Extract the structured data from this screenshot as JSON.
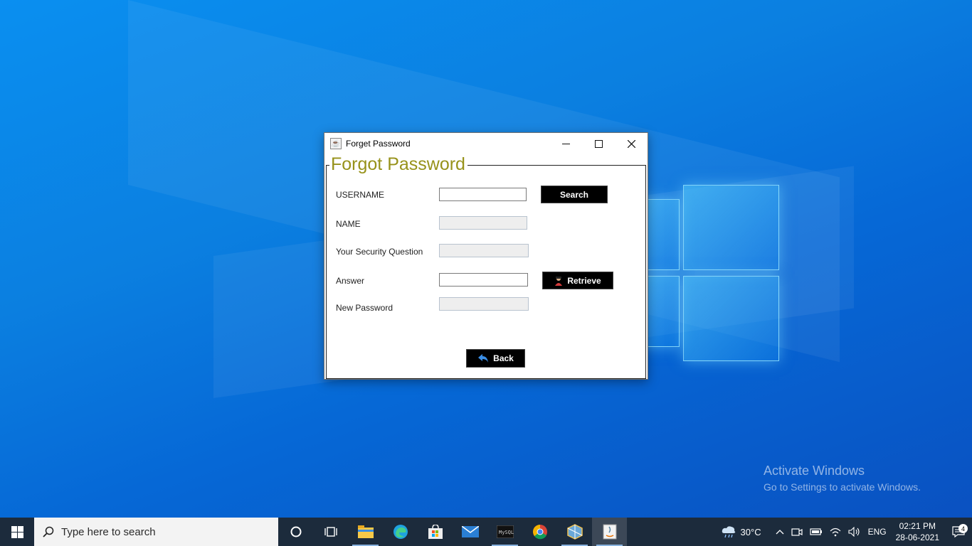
{
  "window": {
    "title": "Forget Password",
    "panel_title": "Forgot Password"
  },
  "form": {
    "username_label": "USERNAME",
    "username_value": "",
    "name_label": "NAME",
    "name_value": "",
    "question_label": "Your Security Question",
    "question_value": "",
    "answer_label": "Answer",
    "answer_value": "",
    "new_password_label": "New Password",
    "new_password_value": "",
    "search_button": "Search",
    "retrieve_button": "Retrieve",
    "back_button": "Back"
  },
  "watermark": {
    "line1": "Activate Windows",
    "line2": "Go to Settings to activate Windows."
  },
  "taskbar": {
    "search_placeholder": "Type here to search",
    "pinned": [
      {
        "name": "cortana-icon"
      },
      {
        "name": "task-view-icon"
      },
      {
        "name": "file-explorer-icon"
      },
      {
        "name": "edge-icon"
      },
      {
        "name": "store-icon"
      },
      {
        "name": "mail-icon"
      },
      {
        "name": "mysql-icon"
      },
      {
        "name": "chrome-icon"
      },
      {
        "name": "virtualbox-icon"
      },
      {
        "name": "java-icon"
      }
    ],
    "weather": "30°C",
    "language": "ENG",
    "time": "02:21 PM",
    "date": "28-06-2021",
    "notification_count": "4"
  }
}
